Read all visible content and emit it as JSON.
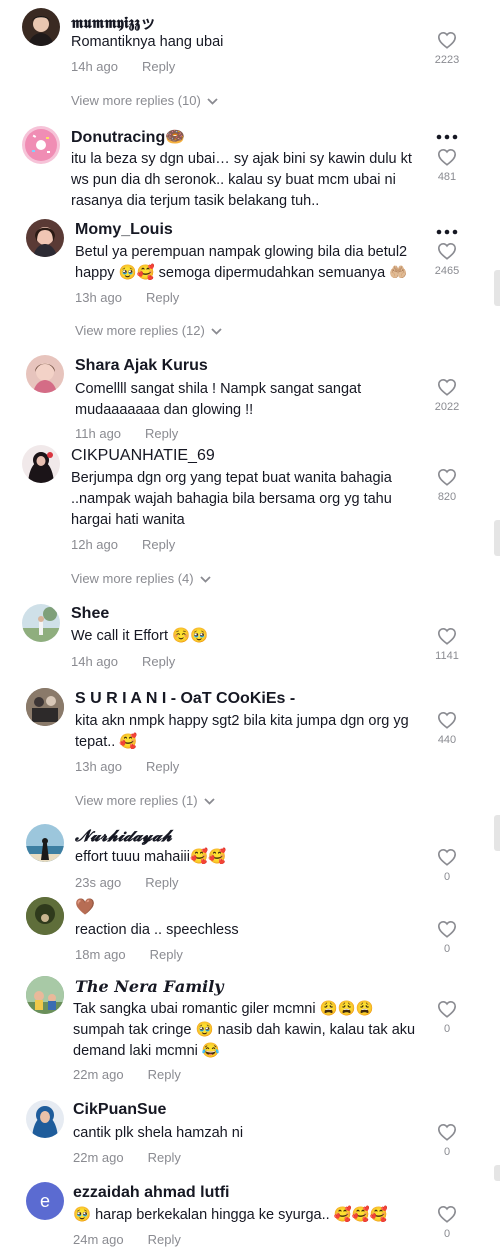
{
  "comments": [
    {
      "id": "c1",
      "username": "𝖒𝖚𝖒𝖒𝖞𝖎𝖟𝖟ッ",
      "text": "Romantiknya hang ubai",
      "time": "14h ago",
      "reply": "Reply",
      "likes": "2223",
      "avatar_color": "#3a2a22"
    },
    {
      "id": "c2",
      "username": "Donutracing🍩",
      "text": "itu la beza sy dgn ubai… sy ajak bini sy kawin dulu kt ws pun dia dh seronok.. kalau sy buat mcm ubai ni rasanya dia terjum tasik belakang tuh..",
      "likes": "481",
      "avatar_color": "#f3a9c7"
    },
    {
      "id": "c3",
      "username": "Momy_Louis",
      "text": "Betul ya perempuan nampak glowing bila dia betul2 happy 🥹🥰 semoga dipermudahkan semuanya 🤲🏼",
      "time": "13h ago",
      "reply": "Reply",
      "likes": "2465",
      "avatar_color": "#5a3a35"
    },
    {
      "id": "c4",
      "username": "Shara Ajak Kurus",
      "text": "Comellll sangat shila ! Nampk sangat sangat mudaaaaaaa dan glowing !!",
      "time": "11h ago",
      "reply": "Reply",
      "likes": "2022",
      "avatar_color": "#d8a7a0"
    },
    {
      "id": "c5",
      "username": "CIKPUANHATIE_69",
      "text": "Berjumpa dgn org yang tepat buat wanita bahagia ..nampak wajah bahagia bila bersama org yg tahu hargai hati wanita",
      "time": "12h ago",
      "reply": "Reply",
      "likes": "820",
      "avatar_color": "#2a1f28"
    },
    {
      "id": "c6",
      "username": "Shee",
      "text": "We call it Effort ☺️🥹",
      "time": "14h ago",
      "reply": "Reply",
      "likes": "1141",
      "avatar_color": "#9fb7a0"
    },
    {
      "id": "c7",
      "username": "S U R I A N I - OaT COoKiEs -",
      "text": "kita akn nmpk happy sgt2 bila kita jumpa dgn org yg tepat.. 🥰",
      "time": "13h ago",
      "reply": "Reply",
      "likes": "440",
      "avatar_color": "#6b5a4c"
    },
    {
      "id": "c8",
      "username": "𝓝𝓾𝓻𝓱𝓲𝓭𝓪𝔂𝓪𝓱",
      "text": "effort tuuu mahaiii🥰🥰",
      "time": "23s ago",
      "reply": "Reply",
      "likes": "0",
      "avatar_color": "#5d8fb0"
    },
    {
      "id": "c9",
      "username": "🤎",
      "text": "reaction dia .. speechless",
      "time": "18m ago",
      "reply": "Reply",
      "likes": "0",
      "avatar_color": "#4a5a2e"
    },
    {
      "id": "c10",
      "username": "𝑻𝒉𝒆 𝑵𝒆𝒓𝒂 𝑭𝒂𝒎𝒊𝒍𝒚",
      "text": "Tak sangka ubai romantic giler mcmni 😩😩😩 sumpah tak cringe 🥹 nasib dah kawin, kalau tak aku demand laki mcmni 😂",
      "time": "22m ago",
      "reply": "Reply",
      "likes": "0",
      "avatar_color": "#6f9c7c"
    },
    {
      "id": "c11",
      "username": "CikPuanSue",
      "text": "cantik plk shela hamzah ni",
      "time": "22m ago",
      "reply": "Reply",
      "likes": "0",
      "avatar_color": "#2d6ea8"
    },
    {
      "id": "c12",
      "username": "ezzaidah ahmad lutfi",
      "text": "🥹 harap berkekalan hingga ke syurga.. 🥰🥰🥰",
      "time": "24m ago",
      "reply": "Reply",
      "likes": "0",
      "avatar_color": "#5b6bd1",
      "avatar_letter": "e"
    }
  ],
  "view_more": [
    {
      "label": "View more replies (10)"
    },
    {
      "label": "View more replies (12)"
    },
    {
      "label": "View more replies (4)"
    },
    {
      "label": "View more replies (1)"
    }
  ],
  "icons": {
    "like": "heart-outline-icon",
    "more": "more-dots-icon",
    "chevron": "chevron-down-icon"
  },
  "colors": {
    "text": "#161823",
    "secondary": "#8a8b91",
    "background": "#ffffff"
  }
}
